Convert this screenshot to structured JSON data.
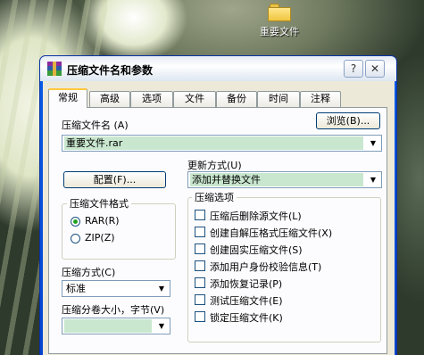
{
  "desktop": {
    "icon_label": "重要文件"
  },
  "window": {
    "title": "压缩文件名和参数",
    "help_glyph": "?",
    "close_glyph": "✕"
  },
  "tabs": [
    {
      "label": "常规",
      "active": true
    },
    {
      "label": "高级"
    },
    {
      "label": "选项"
    },
    {
      "label": "文件"
    },
    {
      "label": "备份"
    },
    {
      "label": "时间"
    },
    {
      "label": "注释"
    }
  ],
  "general": {
    "archive_name_label": "压缩文件名 (A)",
    "browse_button": "浏览(B)...",
    "archive_name_value": "重要文件.rar",
    "profile_button": "配置(F)...",
    "update_mode_label": "更新方式(U)",
    "update_mode_value": "添加并替换文件",
    "format_group_title": "压缩文件格式",
    "format_rar": "RAR(R)",
    "format_zip": "ZIP(Z)",
    "method_label": "压缩方式(C)",
    "method_value": "标准",
    "split_label": "压缩分卷大小，字节(V)",
    "split_value": "",
    "options_group_title": "压缩选项",
    "options": [
      "压缩后删除源文件(L)",
      "创建自解压格式压缩文件(X)",
      "创建固实压缩文件(S)",
      "添加用户身份校验信息(T)",
      "添加恢复记录(P)",
      "测试压缩文件(E)",
      "锁定压缩文件(K)"
    ]
  },
  "colors": {
    "title_bar": "#e6ecf4",
    "selection_green": "#c9e7cf",
    "active_tab_accent": "#ffc83c",
    "radio_dot": "#21a121"
  }
}
